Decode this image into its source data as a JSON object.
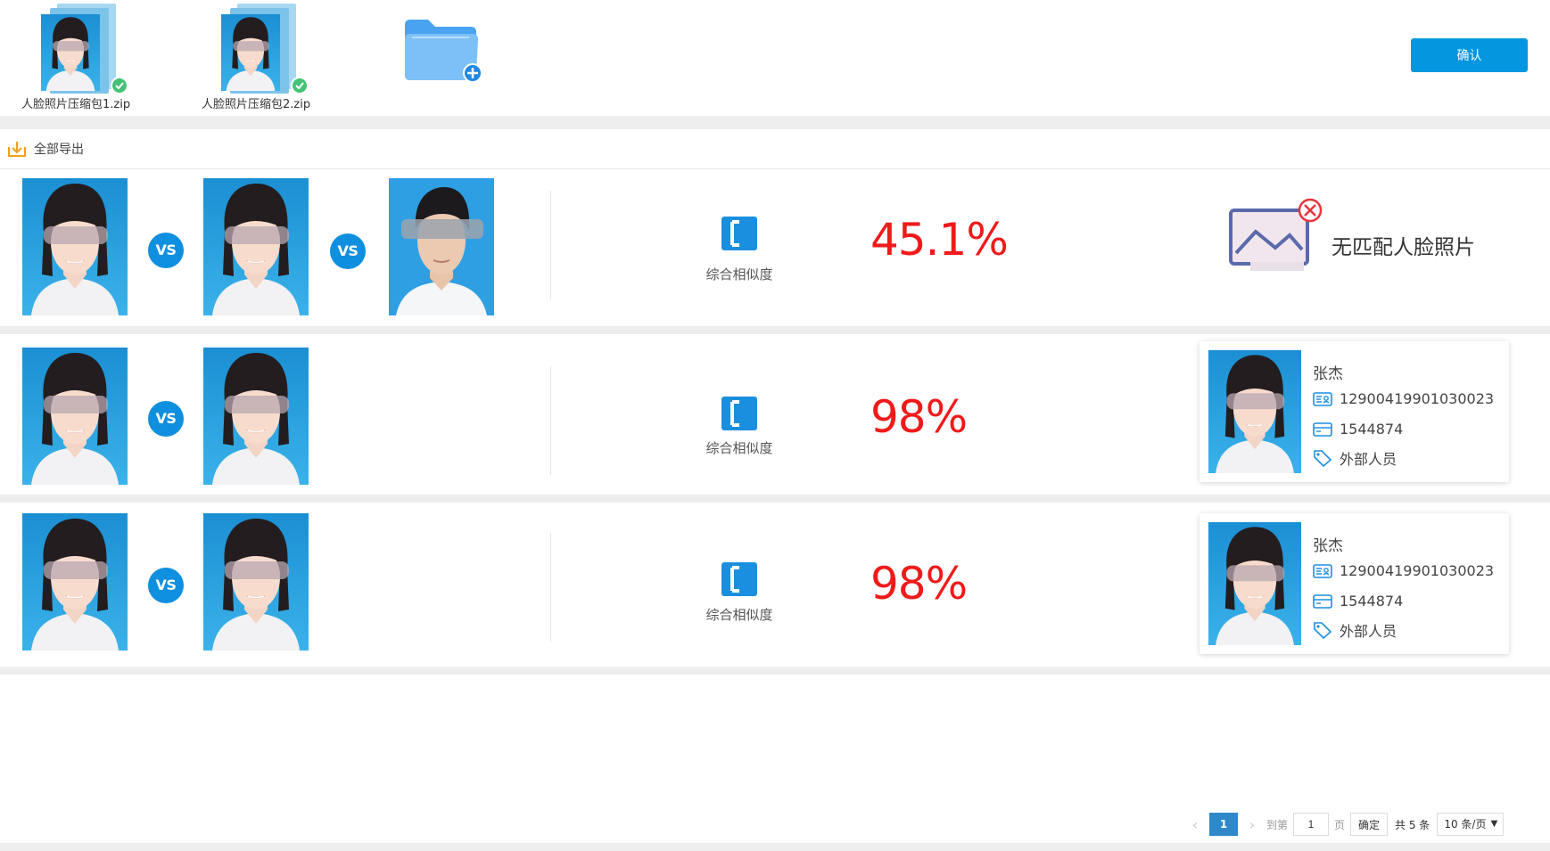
{
  "upload": {
    "files": [
      {
        "name": "人脸照片压缩包1.zip"
      },
      {
        "name": "人脸照片压缩包2.zip"
      }
    ],
    "confirm_label": "确认"
  },
  "toolbar": {
    "export_all_label": "全部导出"
  },
  "results": [
    {
      "vs_label": "VS",
      "photos": [
        "face-photo",
        "face-photo",
        "face-photo"
      ],
      "similarity_label": "综合相似度",
      "score": "45.1%",
      "match": null,
      "no_match_text": "无匹配人脸照片"
    },
    {
      "vs_label": "VS",
      "photos": [
        "face-photo",
        "face-photo"
      ],
      "similarity_label": "综合相似度",
      "score": "98%",
      "match": {
        "name": "张杰",
        "id_number": "12900419901030023",
        "card_number": "1544874",
        "tag": "外部人员"
      }
    },
    {
      "vs_label": "VS",
      "photos": [
        "face-photo",
        "face-photo"
      ],
      "similarity_label": "综合相似度",
      "score": "98%",
      "match": {
        "name": "张杰",
        "id_number": "12900419901030023",
        "card_number": "1544874",
        "tag": "外部人员"
      }
    }
  ],
  "pagination": {
    "current_page": "1",
    "goto_label": "到第",
    "goto_value": "1",
    "page_unit": "页",
    "go_label": "确定",
    "total_label": "共 5 条",
    "page_size_label": "10 条/页"
  },
  "colors": {
    "accent": "#0596e0",
    "score": "#f01a1a",
    "pagination_active": "#2e88c9"
  }
}
